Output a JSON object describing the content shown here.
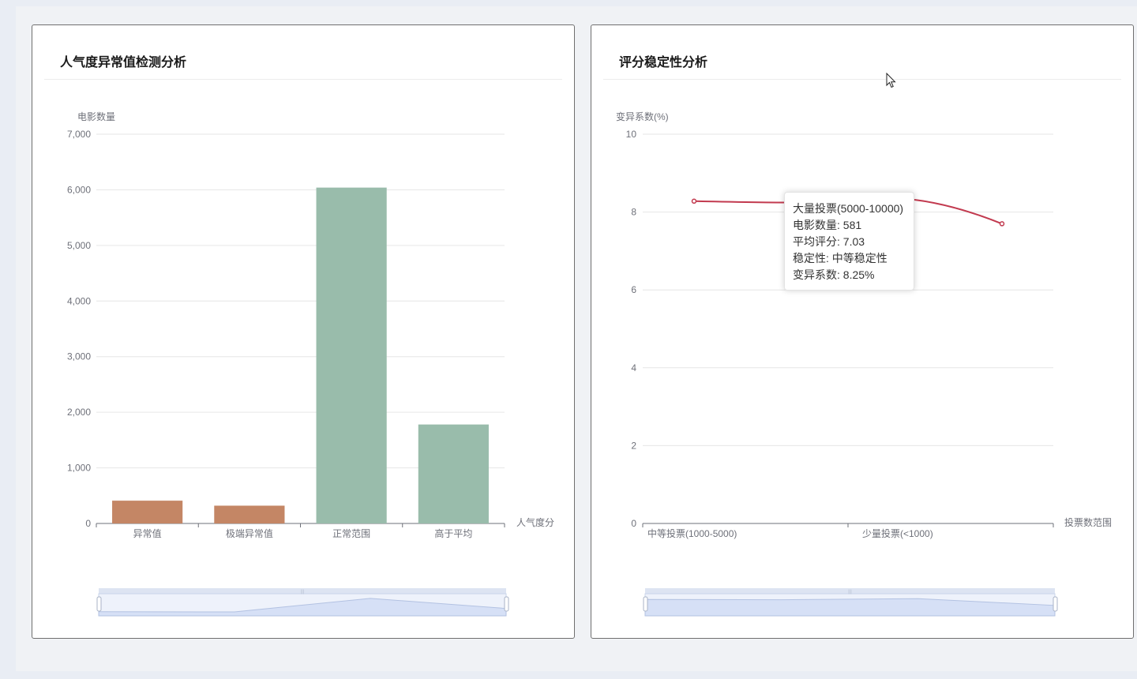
{
  "colors": {
    "anomaly": "#c48665",
    "normal": "#99bcab",
    "line": "#c23a4f",
    "dz_fill": "#dfe8f8",
    "dz_border": "#c9d4ea"
  },
  "left_card": {
    "title": "人气度异常值检测分析"
  },
  "right_card": {
    "title": "评分稳定性分析"
  },
  "tooltip": {
    "line1": "大量投票(5000-10000)",
    "line2": "电影数量: 581",
    "line3": "平均评分: 7.03",
    "line4": "稳定性: 中等稳定性",
    "line5": "变异系数: 8.25%"
  },
  "chart_data": [
    {
      "type": "bar",
      "title": "人气度异常值检测分析",
      "ylabel": "电影数量",
      "xlabel": "人气度分",
      "ylim": [
        0,
        7000
      ],
      "yticks": [
        0,
        1000,
        2000,
        3000,
        4000,
        5000,
        6000,
        7000
      ],
      "ytick_labels": [
        "0",
        "1,000",
        "2,000",
        "3,000",
        "4,000",
        "5,000",
        "6,000",
        "7,000"
      ],
      "categories": [
        "异常值",
        "极端异常值",
        "正常范围",
        "高于平均"
      ],
      "values": [
        410,
        320,
        6040,
        1780
      ],
      "bar_colors": [
        "#c48665",
        "#c48665",
        "#99bcab",
        "#99bcab"
      ],
      "grid": true,
      "datazoom": true
    },
    {
      "type": "line",
      "title": "评分稳定性分析",
      "ylabel": "变异系数(%)",
      "xlabel": "投票数范围",
      "ylim": [
        0,
        10
      ],
      "yticks": [
        0,
        2,
        4,
        6,
        8,
        10
      ],
      "ytick_labels": [
        "0",
        "2",
        "4",
        "6",
        "8",
        "10"
      ],
      "categories": [
        "中等投票(1000-5000)",
        "大量投票(5000-10000)",
        "少量投票(<1000)",
        ""
      ],
      "visible_tick_labels": [
        "中等投票(1000-5000)",
        "少量投票(<1000)"
      ],
      "series": [
        {
          "values": [
            8.28,
            8.25,
            8.35,
            7.7
          ]
        }
      ],
      "grid": true,
      "datazoom": true
    }
  ]
}
